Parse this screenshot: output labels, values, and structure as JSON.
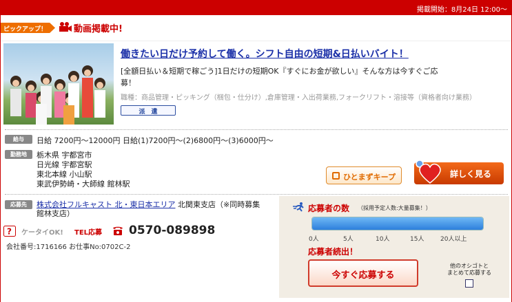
{
  "topbar": {
    "posted": "掲載開始：8月24日 12:00～"
  },
  "pickup": {
    "badge": "ピックアップ！",
    "video": "動画掲載中!"
  },
  "job": {
    "title": "働きたい日だけ予約して働く。シフト自由の短期&日払いバイト！",
    "desc_line1": "[全額日払い＆短期で稼ごう]1日だけの短期OK『すぐにお金が欲しい』そんな方は今すぐご応",
    "desc_line2": "募！",
    "categories": "職種：商品管理・ピッキング（梱包・仕分け）,倉庫管理・入出荷業務,フォークリフト・溶接等（資格者向け業務）",
    "employment_type": "派　遣"
  },
  "salary": {
    "label": "給与",
    "text": "日給 7200円～12000円  日給(1)7200円～(2)6800円～(3)6000円～"
  },
  "location": {
    "label": "勤務地",
    "lines": [
      "栃木県 宇都宮市",
      "日光線 宇都宮駅",
      "東北本線 小山駅",
      "東武伊勢崎・大師線 館林駅"
    ]
  },
  "buttons": {
    "keep": "ひとまずキープ",
    "detail": "詳しく見る",
    "apply": "今すぐ応募する"
  },
  "company": {
    "label": "応募先",
    "name": "株式会社フルキャスト 北・東日本エリア",
    "branch_line1": " 北関東支店（※同時募集",
    "branch_line2": "館林支店）"
  },
  "contact": {
    "keitai": "ケータイOK!",
    "tel_label": "TEL応募",
    "phone": "0570-089898",
    "ids": "会社番号:1716166  お仕事No:0702C-2"
  },
  "applicants": {
    "title": "応募者の数",
    "sub": "（採用予定人数:大量募集！）",
    "ticks": [
      "0人",
      "5人",
      "10人",
      "15人",
      "20人以上"
    ],
    "fill_fraction": 1.0,
    "status": "応募者続出！",
    "other_label_line1": "他のオシゴトと",
    "other_label_line2": "まとめて応募する"
  },
  "colors": {
    "accent": "#cc0000",
    "orange": "#ee6e00",
    "link": "#1a2fa8",
    "panel": "#f2ede4"
  },
  "icons": {
    "camera": "video-camera-icon",
    "runner": "runner-icon",
    "phone": "phone-icon",
    "help": "help-icon",
    "heart": "heart-icon"
  }
}
